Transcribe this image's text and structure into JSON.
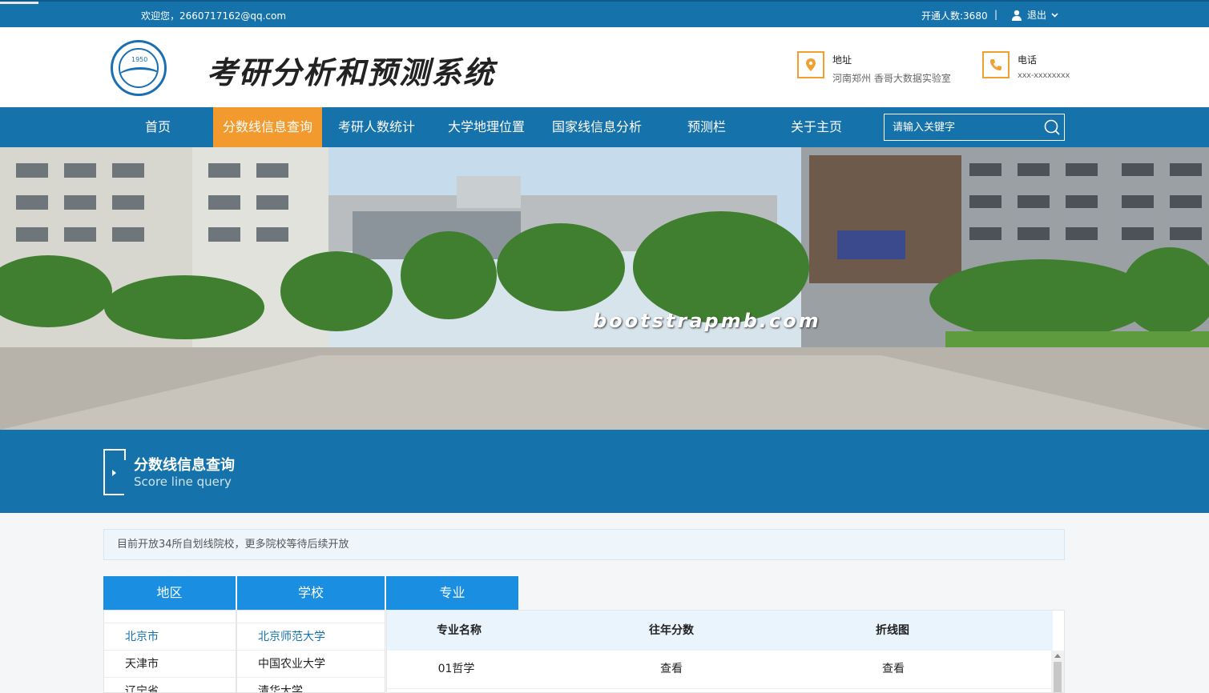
{
  "topbar": {
    "welcome": "欢迎您，2660717162@qq.com",
    "stats": "开通人数:3680",
    "separator": "|",
    "logout_label": "退出"
  },
  "header": {
    "brand_title": "考研分析和预测系统",
    "logo_year": "1950",
    "address_title": "地址",
    "address_value": "河南郑州 香哥大数据实验室",
    "phone_title": "电话",
    "phone_value": "xxx-xxxxxxxx"
  },
  "nav": {
    "items": [
      "首页",
      "分数线信息查询",
      "考研人数统计",
      "大学地理位置",
      "国家线信息分析",
      "预测栏",
      "关于主页"
    ],
    "active_index": 1,
    "search_placeholder": "请输入关键字"
  },
  "banner": {
    "watermark": "bootstrapmb.com"
  },
  "section": {
    "title": "分数线信息查询",
    "subtitle": "Score line query"
  },
  "notice": "目前开放34所自划线院校，更多院校等待后续开放",
  "tabs": [
    "地区",
    "学校",
    "专业"
  ],
  "regions": [
    "北京市",
    "天津市",
    "辽宁省"
  ],
  "schools": [
    "北京师范大学",
    "中国农业大学",
    "清华大学"
  ],
  "table": {
    "headers": [
      "专业名称",
      "往年分数",
      "折线图"
    ],
    "rows": [
      {
        "name": "01哲学",
        "score": "查看",
        "chart": "查看"
      }
    ]
  },
  "colors": {
    "primary": "#1672aa",
    "accent": "#f39a2e",
    "tab": "#1a8ee0"
  }
}
